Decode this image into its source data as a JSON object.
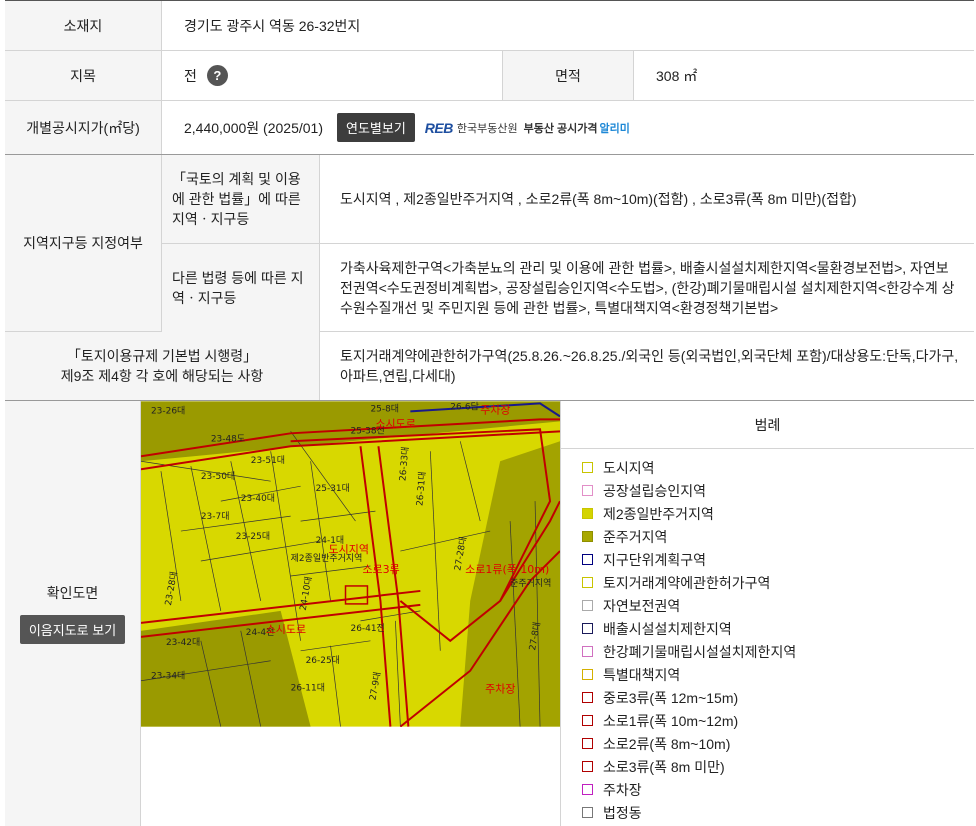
{
  "location": {
    "label": "소재지",
    "value": "경기도 광주시 역동 26-32번지"
  },
  "land_category": {
    "label": "지목",
    "value": "전",
    "help_icon": "question-icon",
    "area_label": "면적",
    "area_value": "308 ㎡"
  },
  "official_price": {
    "label": "개별공시지가(㎡당)",
    "value": "2,440,000원 (2025/01)",
    "yearly_button": "연도별보기",
    "reb_mark": "REB",
    "reb_org": "한국부동산원",
    "reb_text": "부동산 공시가격",
    "reb_alert": "알리미"
  },
  "zoning": {
    "label": "지역지구등 지정여부",
    "sub1_label": "「국토의 계획 및 이용에 관한 법률」에 따른 지역ㆍ지구등",
    "sub1_value": "도시지역 , 제2종일반주거지역 , 소로2류(폭 8m~10m)(접함) , 소로3류(폭 8m 미만)(접합)",
    "sub2_label": "다른 법령 등에 따른 지역ㆍ지구등",
    "sub2_value": "가축사육제한구역<가축분뇨의 관리 및 이용에 관한 법률>, 배출시설설치제한지역<물환경보전법>, 자연보전권역<수도권정비계획법>, 공장설립승인지역<수도법>, (한강)폐기물매립시설 설치제한지역<한강수계 상수원수질개선 및 주민지원 등에 관한 법률>, 특별대책지역<환경정책기본법>"
  },
  "regulation": {
    "label_line1": "「토지이용규제 기본법 시행령」",
    "label_line2": "제9조 제4항 각 호에 해당되는 사항",
    "value": "토지거래계약에관한허가구역(25.8.26.~26.8.25./외국인 등(외국법인,외국단체 포함)/대상용도:단독,다가구,아파트,연립,다세대)"
  },
  "map_section": {
    "label": "확인도면",
    "map_button": "이음지도로 보기",
    "legend_title": "범례",
    "map_labels": [
      "23-26대",
      "25-8대",
      "26-6답",
      "주차장",
      "25-38전",
      "23-48도",
      "23-51대",
      "23-50대",
      "23-40대",
      "25-31대",
      "26-31대",
      "23-7대",
      "23-25대",
      "24-1대",
      "제2종일반주거지역",
      "도시지역",
      "소로3류",
      "소로1류(폭 10m)",
      "준주거지역",
      "27-28대",
      "23-28대",
      "24-4전",
      "소시도로",
      "26-41전",
      "23-42대",
      "26-25대",
      "23-34대",
      "26-11대",
      "27-9대",
      "주차장",
      "27-8대",
      "26-33대",
      "24-10대"
    ]
  },
  "legend": [
    {
      "label": "도시지역",
      "border": "#c8c400",
      "fill": "#ffffff"
    },
    {
      "label": "공장설립승인지역",
      "border": "#e28fc8",
      "fill": "#ffffff"
    },
    {
      "label": "제2종일반주거지역",
      "border": "#c8c400",
      "fill": "#d4d400"
    },
    {
      "label": "준주거지역",
      "border": "#8f8f00",
      "fill": "#a9a900"
    },
    {
      "label": "지구단위계획구역",
      "border": "#000080",
      "fill": "#ffffff"
    },
    {
      "label": "토지거래계약에관한허가구역",
      "border": "#c8c400",
      "fill": "#ffffff"
    },
    {
      "label": "자연보전권역",
      "border": "#aaaaaa",
      "fill": "#ffffff"
    },
    {
      "label": "배출시설설치제한지역",
      "border": "#1a1a5a",
      "fill": "#ffffff"
    },
    {
      "label": "한강폐기물매립시설설치제한지역",
      "border": "#d070c0",
      "fill": "#ffffff"
    },
    {
      "label": "특별대책지역",
      "border": "#d4b000",
      "fill": "#ffffff"
    },
    {
      "label": "중로3류(폭 12m~15m)",
      "border": "#b00000",
      "fill": "#ffffff"
    },
    {
      "label": "소로1류(폭 10m~12m)",
      "border": "#b00000",
      "fill": "#ffffff"
    },
    {
      "label": "소로2류(폭 8m~10m)",
      "border": "#b00000",
      "fill": "#ffffff"
    },
    {
      "label": "소로3류(폭 8m 미만)",
      "border": "#b00000",
      "fill": "#ffffff"
    },
    {
      "label": "주차장",
      "border": "#c020c0",
      "fill": "#ffffff"
    },
    {
      "label": "법정동",
      "border": "#777777",
      "fill": "#ffffff"
    }
  ]
}
